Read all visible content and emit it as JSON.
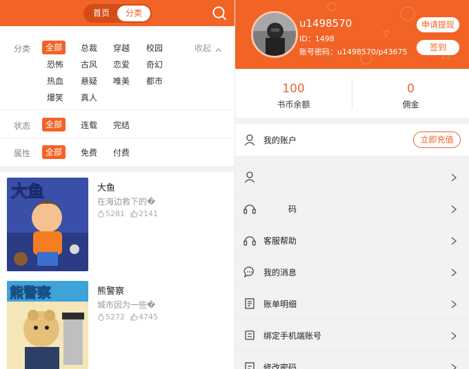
{
  "nav": {
    "home_label": "首页",
    "category_label": "分类",
    "search_icon": "search-icon"
  },
  "filters": {
    "category": {
      "label": "分类",
      "collapse_label": "收起",
      "options": [
        "全部",
        "总裁",
        "穿越",
        "校园",
        "恐怖",
        "古风",
        "恋爱",
        "奇幻",
        "热血",
        "悬疑",
        "唯美",
        "都市",
        "爆笑",
        "真人"
      ],
      "selected": "全部"
    },
    "status": {
      "label": "状态",
      "options": [
        "全部",
        "连载",
        "完结"
      ],
      "selected": "全部"
    },
    "attribute": {
      "label": "属性",
      "options": [
        "全部",
        "免费",
        "付费"
      ],
      "selected": "全部"
    }
  },
  "books": [
    {
      "title": "大鱼",
      "desc": "在海边救下的�",
      "views": "5281",
      "likes": "2141",
      "cover_text": "大鱼"
    },
    {
      "title": "熊警察",
      "desc": "城市因为一些�",
      "views": "5272",
      "likes": "4745",
      "cover_text": "熊警察"
    }
  ],
  "profile": {
    "username": "u1498570",
    "id_text": "ID：1498",
    "cred_text": "账号密码：u1498570/p43675",
    "withdraw_label": "申请提现",
    "checkin_label": "签到"
  },
  "balance": {
    "coins_value": "100",
    "coins_label": "书币余额",
    "commission_value": "0",
    "commission_label": "佣金"
  },
  "account": {
    "label": "我的账户",
    "recharge_label": "立即充值"
  },
  "menu": [
    {
      "label": "",
      "icon": "user-icon"
    },
    {
      "label": "码",
      "icon": "headset-icon"
    },
    {
      "label": "客服帮助",
      "icon": "headset-icon"
    },
    {
      "label": "我的消息",
      "icon": "chat-icon"
    },
    {
      "label": "账单明细",
      "icon": "bill-icon"
    },
    {
      "label": "绑定手机端账号",
      "icon": "phone-bind-icon"
    },
    {
      "label": "修改密码",
      "icon": "lock-edit-icon"
    }
  ],
  "colors": {
    "brand": "#f26326",
    "brand_dark": "#d44d17",
    "accent_num": "#e8623a"
  }
}
